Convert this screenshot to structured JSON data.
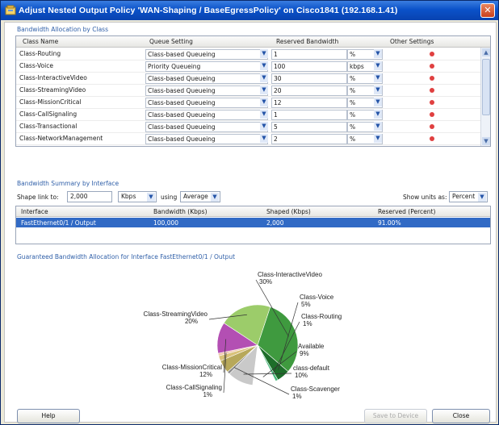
{
  "window": {
    "title": "Adjust Nested Output Policy 'WAN-Shaping / BaseEgressPolicy' on Cisco1841 (192.168.1.41)",
    "close_glyph": "✕"
  },
  "allocation": {
    "section_label": "Bandwidth Allocation by Class",
    "headers": {
      "class_name": "Class Name",
      "queue": "Queue Setting",
      "reserved": "Reserved Bandwidth",
      "other": "Other Settings"
    },
    "rows": [
      {
        "name": "Class-Routing",
        "queue": "Class-based Queueing",
        "value": "1",
        "unit": "%"
      },
      {
        "name": "Class-Voice",
        "queue": "Priority Queueing",
        "value": "100",
        "unit": "kbps"
      },
      {
        "name": "Class-InteractiveVideo",
        "queue": "Class-based Queueing",
        "value": "30",
        "unit": "%"
      },
      {
        "name": "Class-StreamingVideo",
        "queue": "Class-based Queueing",
        "value": "20",
        "unit": "%"
      },
      {
        "name": "Class-MissionCritical",
        "queue": "Class-based Queueing",
        "value": "12",
        "unit": "%"
      },
      {
        "name": "Class-CallSignaling",
        "queue": "Class-based Queueing",
        "value": "1",
        "unit": "%"
      },
      {
        "name": "Class-Transactional",
        "queue": "Class-based Queueing",
        "value": "5",
        "unit": "%"
      },
      {
        "name": "Class-NetworkManagement",
        "queue": "Class-based Queueing",
        "value": "2",
        "unit": "%"
      }
    ],
    "other_indicator_color": "#e04040"
  },
  "summary": {
    "section_label": "Bandwidth Summary by Interface",
    "shape_label": "Shape link to:",
    "shape_value": "2,000",
    "shape_unit": "Kbps",
    "using_label": "using",
    "using_value": "Average",
    "units_label": "Show units as:",
    "units_value": "Percent",
    "headers": {
      "interface": "Interface",
      "bandwidth": "Bandwidth (Kbps)",
      "shaped": "Shaped (Kbps)",
      "reserved": "Reserved (Percent)"
    },
    "row": {
      "interface": "FastEthernet0/1 / Output",
      "bandwidth": "100,000",
      "shaped": "2,000",
      "reserved": "91.00%"
    }
  },
  "pie_section_label": "Guaranteed Bandwidth Allocation for Interface FastEthernet0/1 / Output",
  "chart_data": {
    "type": "pie",
    "slices": [
      {
        "label": "Class-InteractiveVideo",
        "pct_label": "30%",
        "value": 30,
        "color": "#3f9a3f"
      },
      {
        "label": "Class-Voice",
        "pct_label": "5%",
        "value": 5,
        "color": "#1d6e2a"
      },
      {
        "label": "Class-Routing",
        "pct_label": "1%",
        "value": 1,
        "color": "#46b87a"
      },
      {
        "label": "Available",
        "pct_label": "9%",
        "value": 9,
        "color": "#ffffff"
      },
      {
        "label": "class-default",
        "pct_label": "10%",
        "value": 10,
        "color": "#c9c9c9"
      },
      {
        "label": "Class-Scavenger",
        "pct_label": "1%",
        "value": 1,
        "color": "#8a8a8a"
      },
      {
        "label": "Class-Transactional",
        "pct_label": "",
        "value": 5,
        "color": "#b7a85a"
      },
      {
        "label": "Class-NetworkManagement",
        "pct_label": "",
        "value": 2,
        "color": "#d9c27a"
      },
      {
        "label": "Class-CallSignaling",
        "pct_label": "1%",
        "value": 1,
        "color": "#f0c8b0"
      },
      {
        "label": "Class-MissionCritical",
        "pct_label": "12%",
        "value": 12,
        "color": "#b34fb3"
      },
      {
        "label": "Class-StreamingVideo",
        "pct_label": "20%",
        "value": 20,
        "color": "#9ccc6a"
      }
    ]
  },
  "buttons": {
    "help": "Help",
    "save": "Save to Device",
    "close": "Close"
  }
}
